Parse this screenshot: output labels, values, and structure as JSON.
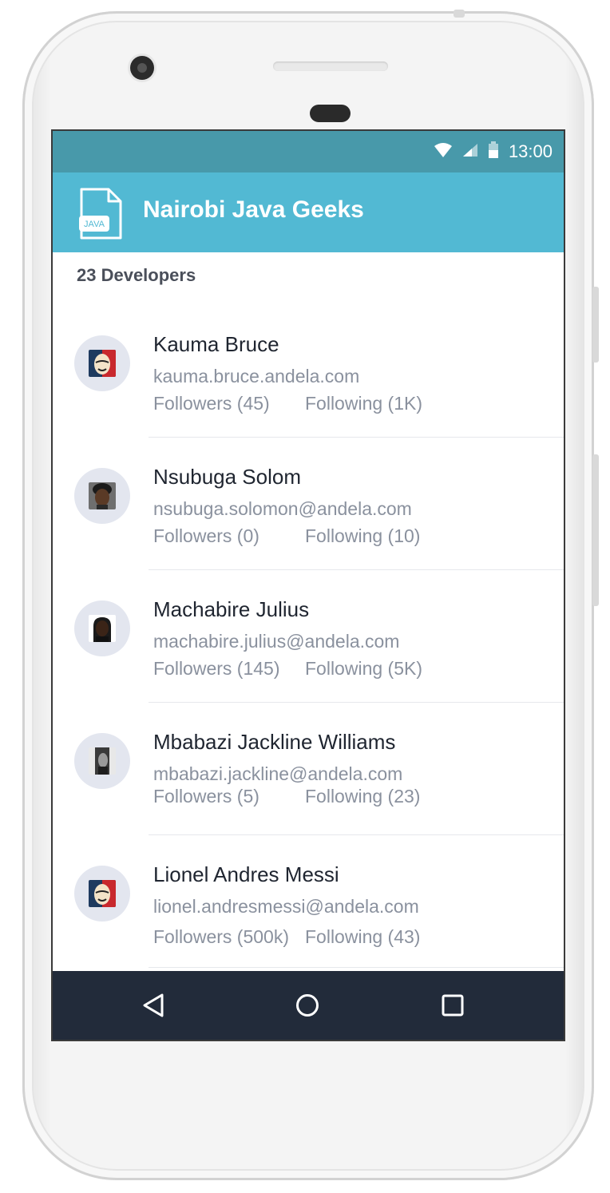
{
  "status_bar": {
    "time": "13:00"
  },
  "app_bar": {
    "title": "Nairobi Java Geeks",
    "logo_text": "JAVA"
  },
  "developer_count": "23 Developers",
  "developers": [
    {
      "name": "Kauma Bruce",
      "email": "kauma.bruce.andela.com",
      "followers": "Followers (45)",
      "following": "Following (1K)",
      "avatar": "mask-avatar"
    },
    {
      "name": "Nsubuga Solom",
      "email": "nsubuga.solomon@andela.com",
      "followers": "Followers (0)",
      "following": "Following (10)",
      "avatar": "portrait-avatar"
    },
    {
      "name": "Machabire Julius",
      "email": "machabire.julius@andela.com",
      "followers": "Followers (145)",
      "following": "Following (5K)",
      "avatar": "portrait-avatar"
    },
    {
      "name": "Mbabazi Jackline Williams",
      "email": "mbabazi.jackline@andela.com",
      "followers": "Followers (5)",
      "following": "Following (23)",
      "avatar": "portrait-avatar"
    },
    {
      "name": "Lionel Andres Messi",
      "email": "lionel.andresmessi@andela.com",
      "followers": "Followers (500k)",
      "following": "Following (43)",
      "avatar": "mask-avatar"
    }
  ],
  "nav_bar": {
    "icons": [
      "back-triangle-icon",
      "home-circle-icon",
      "recents-square-icon"
    ]
  },
  "colors": {
    "status_bar": "#4899aa",
    "app_bar": "#52b9d3",
    "nav_bar": "#222b3a"
  }
}
